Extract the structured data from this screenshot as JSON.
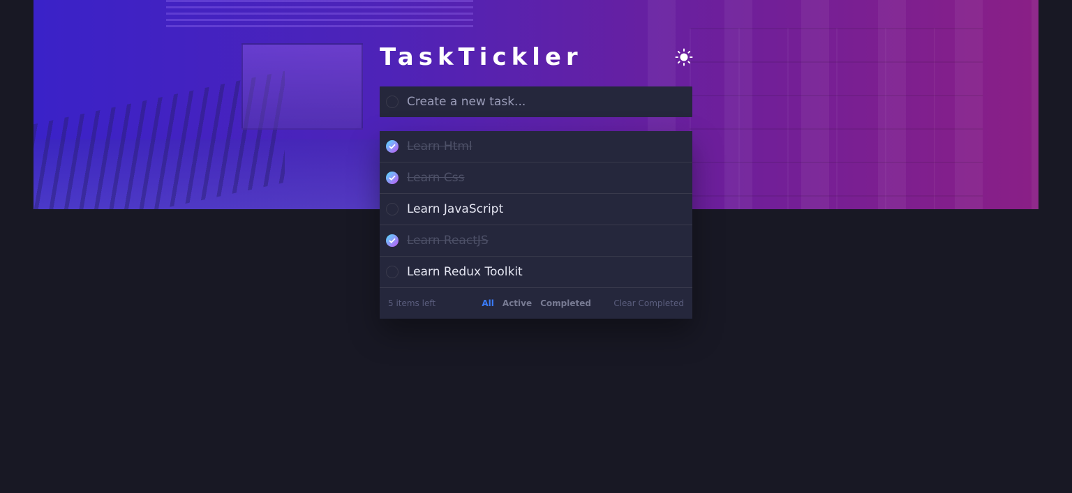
{
  "app": {
    "title": "TaskTickler",
    "theme_icon": "sun-icon"
  },
  "new_task": {
    "placeholder": "Create a new task..."
  },
  "tasks": [
    {
      "label": "Learn Html",
      "completed": true
    },
    {
      "label": "Learn Css",
      "completed": true
    },
    {
      "label": "Learn JavaScript",
      "completed": false
    },
    {
      "label": "Learn ReactJS",
      "completed": true
    },
    {
      "label": "Learn Redux Toolkit",
      "completed": false
    }
  ],
  "footer": {
    "items_left": "5 items left",
    "filters": [
      "All",
      "Active",
      "Completed"
    ],
    "active_filter": "All",
    "clear_label": "Clear Completed"
  },
  "colors": {
    "background": "#181824",
    "card": "#25273c",
    "active_filter": "#3a7cfd",
    "check_gradient_start": "#55ddff",
    "check_gradient_end": "#c058f3"
  }
}
